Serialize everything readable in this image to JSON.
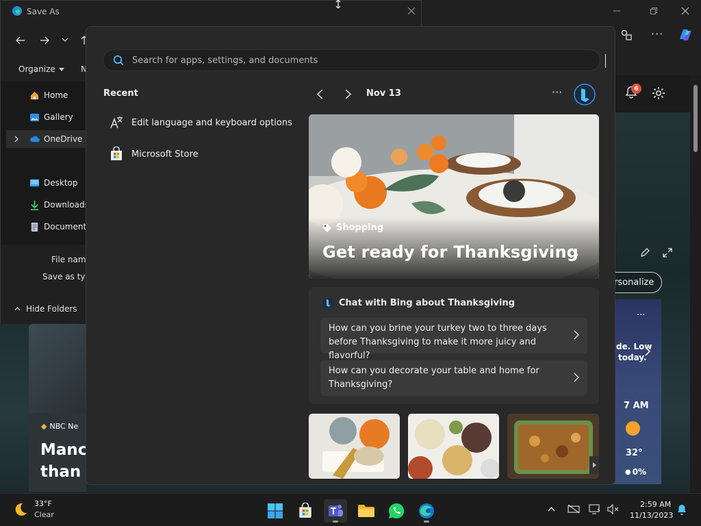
{
  "save_as": {
    "title": "Save As",
    "organize": "Organize",
    "new_folder_partial": "N",
    "tree": {
      "home": "Home",
      "gallery": "Gallery",
      "onedrive": "OneDrive",
      "desktop": "Desktop",
      "downloads": "Downloads",
      "documents": "Documents"
    },
    "file_name_label": "File name",
    "save_as_type_label": "Save as type",
    "hide_folders": "Hide Folders"
  },
  "edge_bg": {
    "bell_badge": "6",
    "personalize": "ersonalize",
    "weather": {
      "partial_line1": "de. Low",
      "partial_line2": "today.",
      "time": "7 AM",
      "temp": "32°",
      "precip": "0%"
    },
    "news": {
      "source": "NBC Ne",
      "headline_line1": "Manch",
      "headline_line2": "than B"
    }
  },
  "search": {
    "placeholder": "Search for apps, settings, and documents"
  },
  "recent": {
    "title": "Recent",
    "items": [
      {
        "label": "Edit language and keyboard options"
      },
      {
        "label": "Microsoft Store"
      }
    ]
  },
  "highlights": {
    "date": "Nov 13",
    "hero": {
      "category": "Shopping",
      "title": "Get ready for Thanksgiving"
    },
    "bing_chat": {
      "heading": "Chat with Bing about Thanksgiving",
      "questions": [
        "How can you brine your turkey two to three days before Thanksgiving to make it more juicy and flavorful?",
        "How can you decorate your table and home for Thanksgiving?"
      ]
    }
  },
  "taskbar": {
    "weather_temp": "33°F",
    "weather_cond": "Clear",
    "time": "2:59 AM",
    "date": "11/13/2023"
  },
  "colors": {
    "accent": "#4cc2ff",
    "flyout_bg": "#282828",
    "taskbar_bg": "#1c1c1c"
  }
}
